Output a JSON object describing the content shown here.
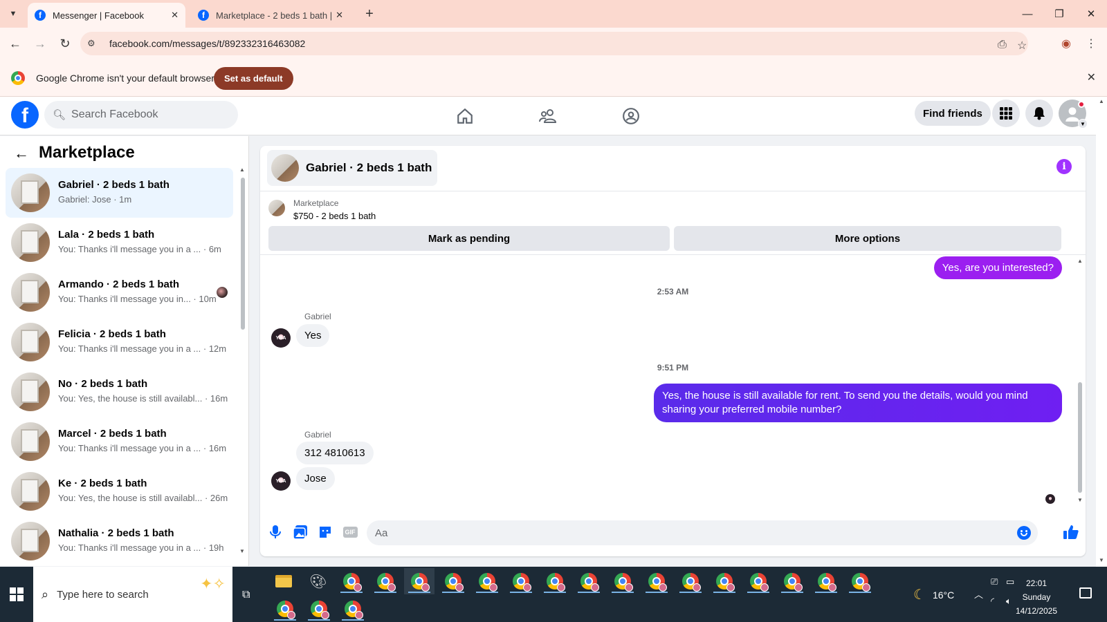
{
  "browser": {
    "tabs": [
      {
        "title": "Messenger | Facebook",
        "active": true
      },
      {
        "title": "Marketplace - 2 beds 1 bath | Fa",
        "active": false
      }
    ],
    "url": "facebook.com/messages/t/892332316463082",
    "infobar": {
      "message": "Google Chrome isn't your default browser",
      "button": "Set as default"
    }
  },
  "facebook": {
    "search_placeholder": "Search Facebook",
    "find_friends": "Find friends",
    "logo": "f"
  },
  "sidebar": {
    "title": "Marketplace",
    "conversations": [
      {
        "name": "Gabriel · 2 beds 1 bath",
        "snippet": "Gabriel: Jose · 1m",
        "selected": true
      },
      {
        "name": "Lala · 2 beds 1 bath",
        "snippet": "You: Thanks i'll message you in a ...  · 6m"
      },
      {
        "name": "Armando · 2 beds 1 bath",
        "snippet": "You: Thanks i'll message you in... · 10m"
      },
      {
        "name": "Felicia · 2 beds 1 bath",
        "snippet": "You: Thanks i'll message you in a ... · 12m"
      },
      {
        "name": "No · 2 beds 1 bath",
        "snippet": "You: Yes, the house is still availabl... · 16m"
      },
      {
        "name": "Marcel · 2 beds 1 bath",
        "snippet": "You: Thanks i'll message you in a ... · 16m"
      },
      {
        "name": "Ke · 2 beds 1 bath",
        "snippet": "You: Yes, the house is still availabl... · 26m"
      },
      {
        "name": "Nathalia · 2 beds 1 bath",
        "snippet": "You: Thanks i'll message you in a ... · 19h"
      }
    ]
  },
  "chat": {
    "header_name": "Gabriel · 2 beds 1 bath",
    "listing_source": "Marketplace",
    "listing_title": "$750 - 2 beds 1 bath",
    "mark_pending": "Mark as pending",
    "more_options": "More options",
    "messages": {
      "out_1": "Yes, are you interested?",
      "ts_1": "2:53 AM",
      "sender_1": "Gabriel",
      "in_1": "Yes",
      "ts_2": "9:51 PM",
      "out_2": "Yes, the house is still available for rent. To send you the details, would you mind sharing your preferred mobile number?",
      "sender_2": "Gabriel",
      "in_2": "312 4810613",
      "in_3": "Jose"
    },
    "composer_placeholder": "Aa",
    "gif_label": "GIF"
  },
  "taskbar": {
    "search_placeholder": "Type here to search",
    "weather": "16°C",
    "time": "22:01",
    "day": "Sunday",
    "date": "14/12/2025"
  },
  "colors": {
    "facebook_blue": "#0866ff",
    "message_out": "#5a2bea",
    "chrome_tab": "#fbd9cf"
  }
}
